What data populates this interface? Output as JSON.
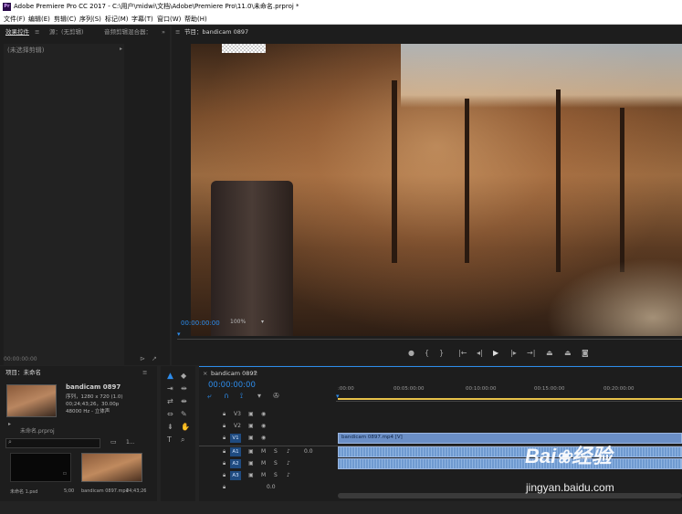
{
  "window": {
    "title": "Adobe Premiere Pro CC 2017 - C:\\用户\\midwi\\文档\\Adobe\\Premiere Pro\\11.0\\未命名.prproj *",
    "app_icon": "Pr"
  },
  "menu": [
    "文件(F)",
    "编辑(E)",
    "剪辑(C)",
    "序列(S)",
    "标记(M)",
    "字幕(T)",
    "窗口(W)",
    "帮助(H)"
  ],
  "effect_controls": {
    "tab_active": "效果控件",
    "tab2": "源：(无剪辑)",
    "tab3": "音频剪辑混合器：",
    "no_clip": "(未选择剪辑)",
    "timecode": "00:00:00:00"
  },
  "program_monitor": {
    "tab": "节目：bandicam 0897",
    "timecode": "00:00:00:00",
    "zoom": "100%"
  },
  "project": {
    "tab": "项目：未命名",
    "clip_name": "bandicam 0897",
    "info_line1": "序列，1280 x 720 (1.0)",
    "info_line2": "00;24;43;26，30.00p",
    "info_line3": "48000 Hz - 立体声",
    "bin_name": "未命名.prproj",
    "item_count": "1...",
    "search_placeholder": "",
    "items": [
      {
        "name": "未命名 1.psd",
        "duration": "5;00"
      },
      {
        "name": "bandicam 0897.mp4",
        "duration": "24;43;26"
      }
    ]
  },
  "timeline": {
    "tab": "bandicam 0897",
    "timecode": "00:00:00:00",
    "ruler": [
      ":00:00",
      "00:05:00:00",
      "00:10:00:00",
      "00:15:00:00",
      "00:20:00:00"
    ],
    "video_tracks": [
      "V3",
      "V2",
      "V1"
    ],
    "audio_tracks": [
      "A1",
      "A2",
      "A3"
    ],
    "audio_level": "0.0",
    "master_level": "0.0",
    "clip_label": "bandicam 0897.mp4 [V]"
  },
  "watermark": {
    "brand": "Bai",
    "brand_suffix": "经验",
    "url": "jingyan.baidu.com"
  },
  "colors": {
    "accent_blue": "#2d8ceb",
    "video_clip": "#6b8fc6",
    "audio_clip": "#6f9ad0",
    "playhead": "#e8c24a",
    "panel_bg": "#1d1d1d"
  }
}
